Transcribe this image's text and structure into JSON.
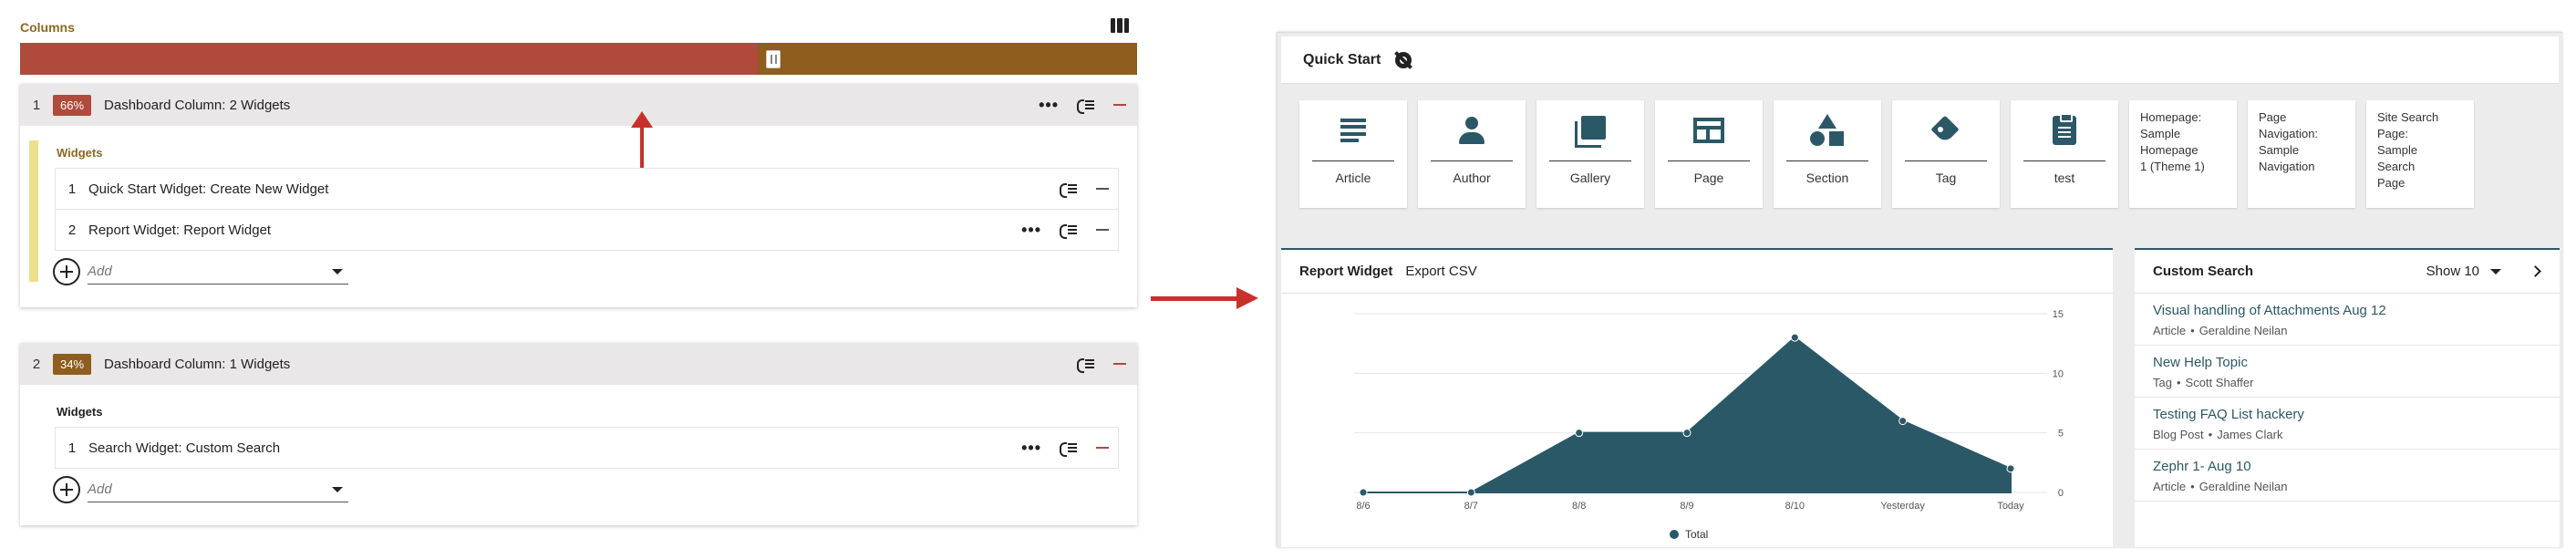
{
  "editor": {
    "columns_label": "Columns",
    "split": {
      "first_fraction": 0.66,
      "colors": {
        "first": "#b04a3c",
        "second": "#8f5d1d"
      }
    },
    "columns": [
      {
        "index": "1",
        "percent": "66%",
        "title": "Dashboard Column: 2 Widgets",
        "widgets_label": "Widgets",
        "widgets": [
          {
            "index": "1",
            "label": "Quick Start Widget: Create New Widget"
          },
          {
            "index": "2",
            "label": "Report Widget: Report Widget"
          }
        ],
        "add_placeholder": "Add"
      },
      {
        "index": "2",
        "percent": "34%",
        "title": "Dashboard Column: 1 Widgets",
        "widgets_label": "Widgets",
        "widgets": [
          {
            "index": "1",
            "label": "Search Widget: Custom Search"
          }
        ],
        "add_placeholder": "Add"
      }
    ]
  },
  "dashboard": {
    "quick_start": {
      "title": "Quick Start",
      "tiles": [
        {
          "label": "Article",
          "icon": "article-icon"
        },
        {
          "label": "Author",
          "icon": "author-icon"
        },
        {
          "label": "Gallery",
          "icon": "gallery-icon"
        },
        {
          "label": "Page",
          "icon": "page-icon"
        },
        {
          "label": "Section",
          "icon": "section-icon"
        },
        {
          "label": "Tag",
          "icon": "tag-icon"
        },
        {
          "label": "test",
          "icon": "clipboard-icon"
        }
      ],
      "text_tiles": [
        [
          "Homepage:",
          "Sample",
          "Homepage",
          "1 (Theme 1)"
        ],
        [
          "Page",
          "Navigation:",
          "Sample",
          "Navigation"
        ],
        [
          "Site Search",
          "Page:",
          "Sample",
          "Search",
          "Page"
        ]
      ]
    },
    "report": {
      "title": "Report Widget",
      "export_label": "Export CSV"
    },
    "search": {
      "title": "Custom Search",
      "show_label": "Show 10",
      "results": [
        {
          "title": "Visual handling of Attachments Aug 12",
          "type": "Article",
          "author": "Geraldine Neilan"
        },
        {
          "title": "New Help Topic",
          "type": "Tag",
          "author": "Scott Shaffer"
        },
        {
          "title": "Testing FAQ List hackery",
          "type": "Blog Post",
          "author": "James Clark"
        },
        {
          "title": "Zephr 1- Aug 10",
          "type": "Article",
          "author": "Geraldine Neilan"
        }
      ]
    }
  },
  "colors": {
    "accent": "#2b5866",
    "arrow": "#c9302c"
  },
  "chart_data": {
    "type": "area",
    "categories": [
      "8/6",
      "8/7",
      "8/8",
      "8/9",
      "8/10",
      "Yesterday",
      "Today"
    ],
    "series": [
      {
        "name": "Total",
        "values": [
          0,
          0,
          5,
          5,
          13,
          6,
          2
        ]
      }
    ],
    "yticks": [
      "0",
      "5",
      "10",
      "15"
    ],
    "ylim": [
      0,
      15
    ],
    "legend": "bottom-center",
    "color": "#2b5866"
  }
}
